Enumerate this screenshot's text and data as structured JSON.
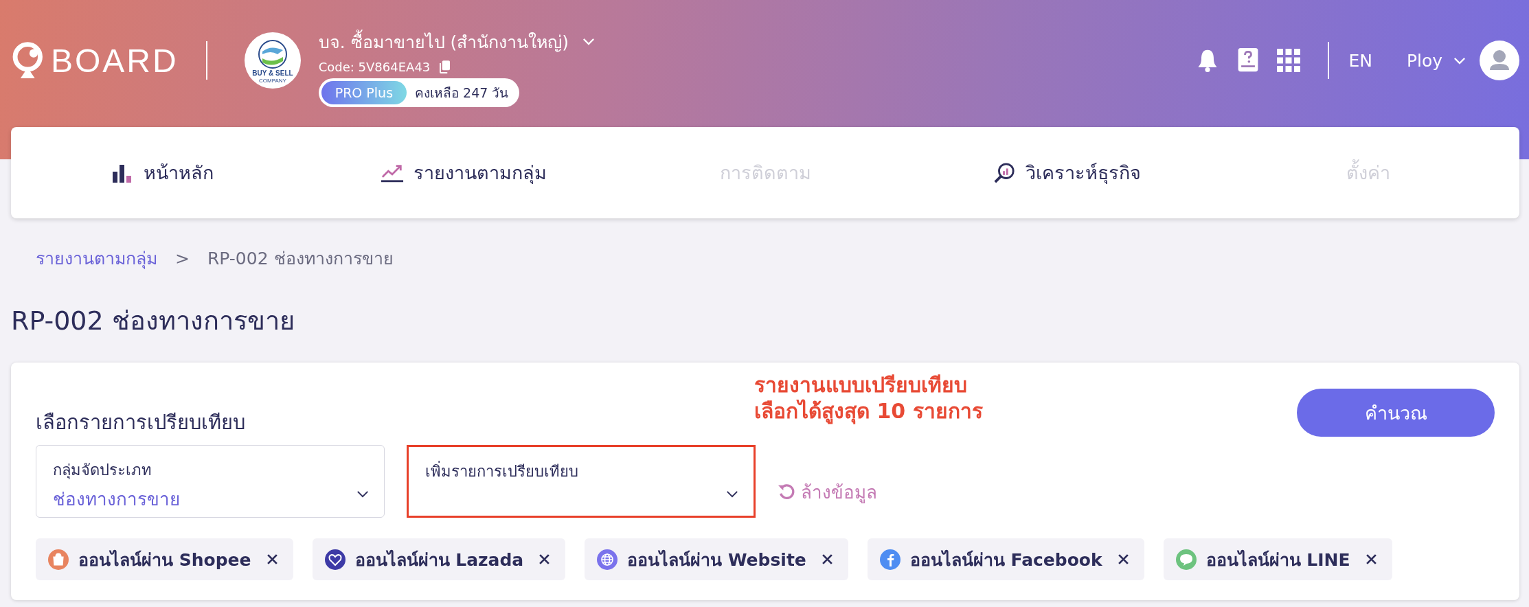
{
  "header": {
    "brand": "BOARD",
    "company": {
      "name": "บจ. ซื้อมาขายไป (สำนักงานใหญ่)",
      "logo_lines": [
        "BUY & SELL",
        "COMPANY"
      ],
      "code": "Code: 5V864EA43",
      "plan": "PRO Plus",
      "remaining": "คงเหลือ 247 วัน"
    },
    "language": "EN",
    "user": "Ploy"
  },
  "nav": [
    {
      "label": "หน้าหลัก",
      "kind": "bars",
      "disabled": false
    },
    {
      "label": "รายงานตามกลุ่ม",
      "kind": "trend",
      "disabled": false
    },
    {
      "label": "การติดตาม",
      "kind": "none",
      "disabled": true
    },
    {
      "label": "วิเคราะห์ธุรกิจ",
      "kind": "magnifier",
      "disabled": false
    },
    {
      "label": "ตั้งค่า",
      "kind": "none",
      "disabled": true
    }
  ],
  "breadcrumb": [
    "รายงานตามกลุ่ม",
    ">",
    "RP-002 ช่องทางการขาย"
  ],
  "title": "RP-002 ช่องทางการขาย",
  "panel": {
    "heading": "เลือกรายการเปรียบเทียบ",
    "annotation": [
      "รายงานแบบเปรียบเทียบ",
      "เลือกได้สูงสุด 10 รายการ"
    ],
    "button": "คำนวณ",
    "fields": [
      {
        "label": "กลุ่มจัดประเภท",
        "value": "ช่องทางการขาย",
        "highlighted": false
      },
      {
        "label": "เพิ่มรายการเปรียบเทียบ",
        "highlighted": true
      }
    ],
    "clear": "ล้างข้อมูล",
    "chips": [
      {
        "label": "ออนไลน์ผ่าน Shopee",
        "kind": "bag",
        "color": "#e8845f"
      },
      {
        "label": "ออนไลน์ผ่าน Lazada",
        "kind": "heart",
        "color": "#3d3aa6"
      },
      {
        "label": "ออนไลน์ผ่าน Website",
        "kind": "globe",
        "color": "#7a72ec"
      },
      {
        "label": "ออนไลน์ผ่าน Facebook",
        "kind": "f",
        "color": "#4e8df2"
      },
      {
        "label": "ออนไลน์ผ่าน LINE",
        "kind": "bubble",
        "color": "#6dc37f"
      }
    ]
  }
}
